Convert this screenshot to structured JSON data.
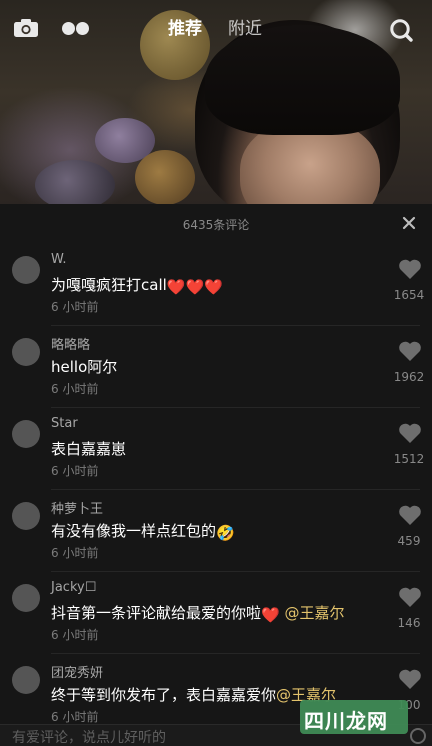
{
  "video": {
    "tabs": [
      {
        "label": "推荐",
        "active": true
      },
      {
        "label": "附近",
        "active": false
      }
    ],
    "icons": [
      "camera-icon",
      "live-dots-icon",
      "search-icon"
    ]
  },
  "comments_panel": {
    "count_label": "6435条评论",
    "close_icon": "close-icon",
    "comments": [
      {
        "user": "W.",
        "text": "为嘎嘎疯狂打call",
        "emoji": "❤️❤️❤️",
        "mention": "",
        "time": "6 小时前",
        "likes": "1654"
      },
      {
        "user": "略略略",
        "text": "hello阿尔",
        "emoji": "",
        "mention": "",
        "time": "6 小时前",
        "likes": "1962"
      },
      {
        "user": "Star",
        "text": "表白嘉嘉崽",
        "emoji": "",
        "mention": "",
        "time": "6 小时前",
        "likes": "1512"
      },
      {
        "user": "种萝卜王",
        "text": "有没有像我一样点红包的",
        "emoji": "🤣",
        "mention": "",
        "time": "6 小时前",
        "likes": "459"
      },
      {
        "user": "Jacky☐",
        "text": "抖音第一条评论献给最爱的你啦",
        "emoji": "❤️",
        "mention": "@王嘉尔",
        "time": "6 小时前",
        "likes": "146"
      },
      {
        "user": "团宠秀妍",
        "text": "终于等到你发布了，表白嘉嘉爱你",
        "emoji": "",
        "mention": "@王嘉尔",
        "time": "6 小时前",
        "likes": "100"
      }
    ]
  },
  "bottom_bar": {
    "placeholder": "有爱评论，说点儿好听的"
  },
  "watermark": {
    "text": "四川龙网"
  },
  "colors": {
    "mention": "#e3c36c",
    "panel_bg": "#161616",
    "heart_gray": "#6e6e6e",
    "watermark_bg": "#3f8a55"
  }
}
